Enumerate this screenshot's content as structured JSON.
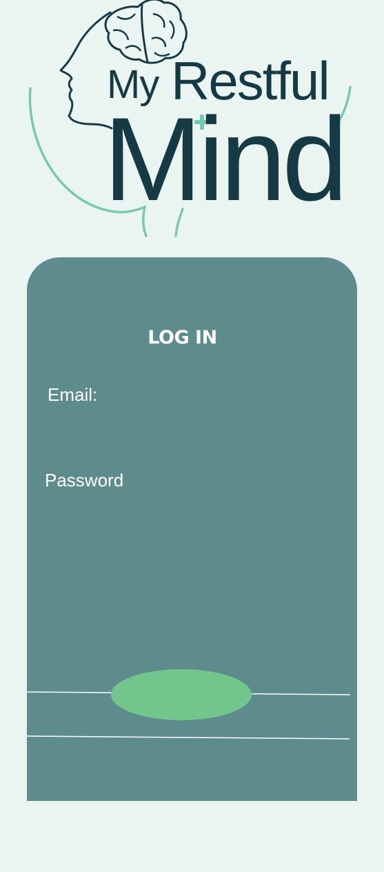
{
  "logo": {
    "word_my": "My",
    "word_restful": "Restful",
    "word_mind": "Mind",
    "icon": "head-brain-icon"
  },
  "login": {
    "title": "LOG IN",
    "email_label": "Email:",
    "email_value": "",
    "password_label": "Password",
    "password_value": "",
    "submit_label": ""
  },
  "colors": {
    "background": "#eaf5f1",
    "card": "#5e8c8c",
    "logo_dark": "#163a44",
    "logo_accent": "#79c7b3",
    "button": "#72c68c"
  }
}
